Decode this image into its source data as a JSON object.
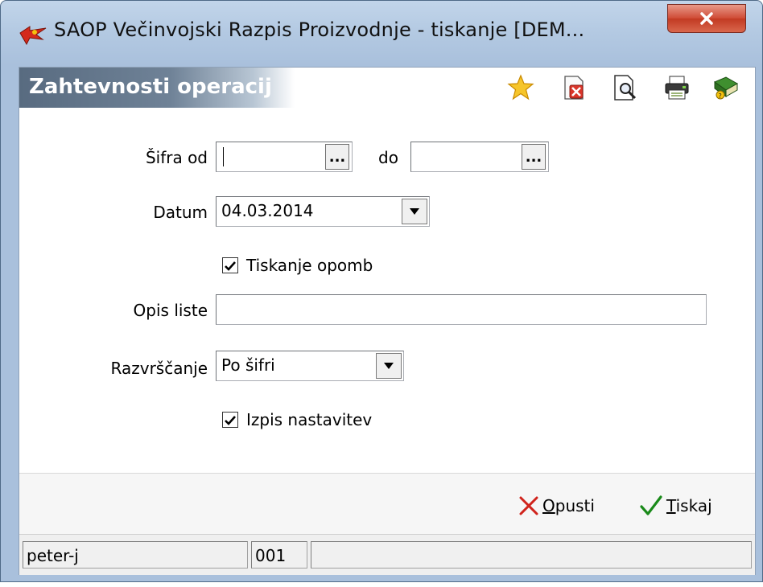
{
  "window": {
    "title": "SAOP Večinvojski Razpis Proizvodnje - tiskanje [DEM...",
    "close_label": "x"
  },
  "header": {
    "title": "Zahtevnosti operacij",
    "toolbar_icons": [
      "star-icon",
      "delete-icon",
      "print-preview-icon",
      "printer-icon",
      "help-book-icon"
    ]
  },
  "form": {
    "sifra_od_label": "Šifra od",
    "sifra_od_value": "",
    "do_label": "do",
    "sifra_do_value": "",
    "ellipsis": "...",
    "datum_label": "Datum",
    "datum_value": "04.03.2014",
    "tiskanje_opomb_label": "Tiskanje opomb",
    "tiskanje_opomb_checked": true,
    "opis_liste_label": "Opis liste",
    "opis_liste_value": "",
    "razvrscanje_label": "Razvrščanje",
    "razvrscanje_value": "Po šifri",
    "izpis_nastavitev_label": "Izpis nastavitev",
    "izpis_nastavitev_checked": true
  },
  "actions": {
    "cancel_label_underlined": "O",
    "cancel_label_rest": "pusti",
    "print_label_underlined": "T",
    "print_label_rest": "iskaj"
  },
  "status": {
    "user": "peter-j",
    "code": "001",
    "info": ""
  },
  "colors": {
    "header_gradient_dark": "#586b80",
    "close_red": "#c23a22",
    "cancel_x": "#d0231c",
    "print_check": "#1a8a1a",
    "star": "#f4b400"
  }
}
